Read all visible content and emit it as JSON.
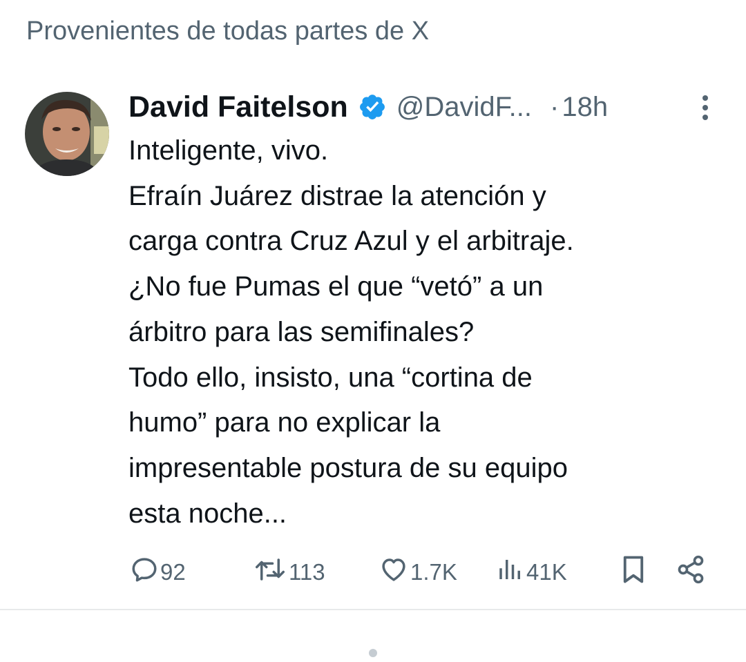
{
  "context_header": "Provenientes de todas partes de X",
  "tweet": {
    "author": {
      "name": "David Faitelson",
      "handle": "@DavidF...",
      "verified": true,
      "avatar_icon": "profile-photo"
    },
    "separator": "·",
    "time": "18h",
    "more_icon": "more-vertical-icon",
    "text_lines": [
      "Inteligente, vivo.",
      "Efraín Juárez distrae la atención y",
      "carga contra Cruz Azul y el arbitraje.",
      "¿No fue Pumas el que “vetó” a un",
      "árbitro para las semifinales?",
      "Todo ello, insisto, una “cortina de",
      "humo” para no explicar la",
      "impresentable postura de su equipo",
      "esta noche..."
    ],
    "actions": {
      "replies": {
        "icon": "reply-icon",
        "count": "92"
      },
      "reposts": {
        "icon": "repost-icon",
        "count": "113"
      },
      "likes": {
        "icon": "heart-icon",
        "count": "1.7K"
      },
      "views": {
        "icon": "views-icon",
        "count": "41K"
      },
      "bookmark": {
        "icon": "bookmark-icon"
      },
      "share": {
        "icon": "share-icon"
      }
    }
  },
  "colors": {
    "text_primary": "#0f1419",
    "text_secondary": "#536471",
    "verified_blue": "#1d9bf0",
    "divider": "#e7e9ea"
  }
}
